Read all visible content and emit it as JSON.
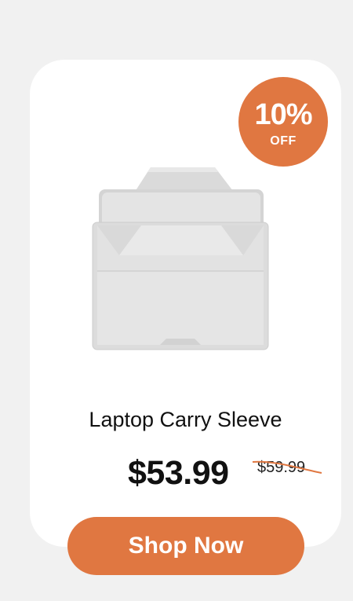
{
  "badge": {
    "percent": "10%",
    "label": "OFF"
  },
  "product": {
    "name": "Laptop Carry Sleeve",
    "price": "$53.99",
    "original_price": "$59.99",
    "image_icon": "laptop-sleeve-image"
  },
  "cta": {
    "label": "Shop Now"
  },
  "colors": {
    "accent": "#e07741",
    "background": "#f1f1f1",
    "card": "#ffffff",
    "text": "#111111"
  }
}
